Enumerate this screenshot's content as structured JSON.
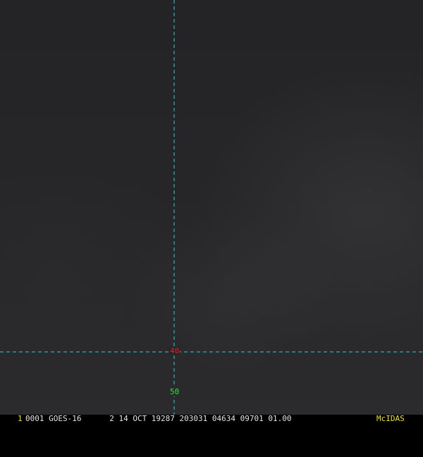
{
  "status_bar": {
    "frame_number": "1",
    "text": "0001 GOES-16      2 14 OCT 19287 203031 04634 09701 01.00",
    "software": "McIDAS"
  },
  "grid_labels": {
    "lat_label": "40",
    "lon_label": "50"
  },
  "colors": {
    "grid_line": "#35c9d8",
    "lat_label": "#d6231f",
    "lon_label": "#29e63a",
    "frame_number": "#f2e31a",
    "software_label": "#f2e31a",
    "status_text": "#e6e6e6"
  }
}
